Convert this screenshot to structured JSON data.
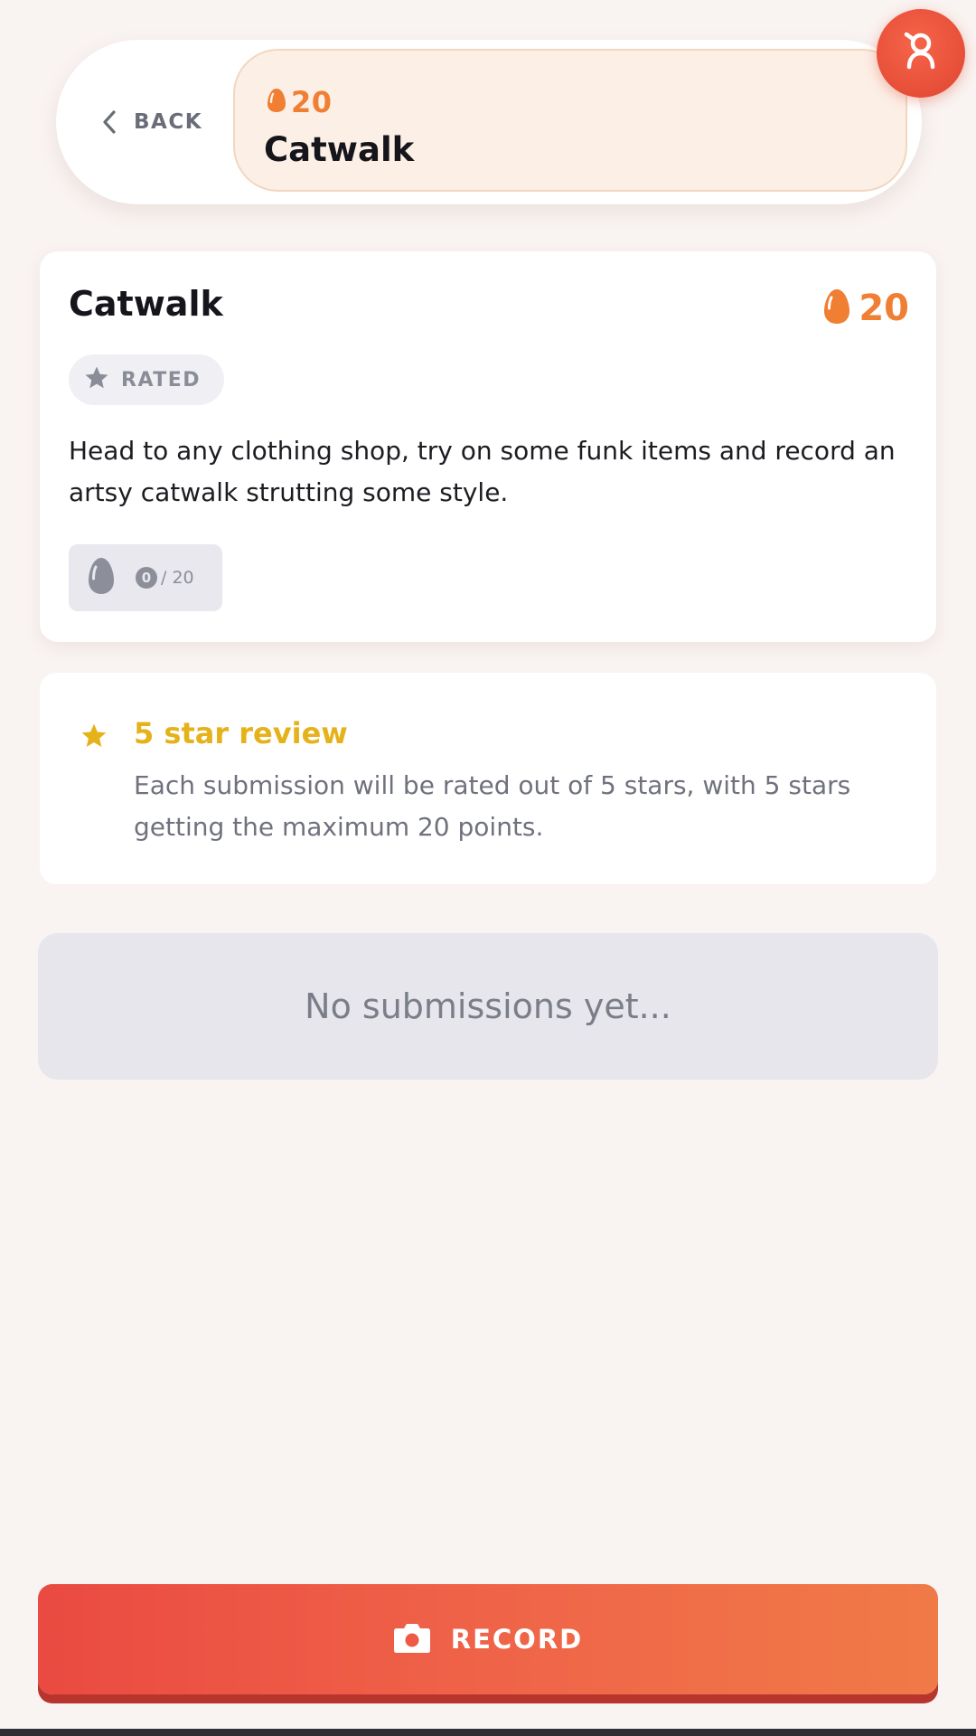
{
  "colors": {
    "accent": "#f07e33",
    "record_gradient_start": "#ea4a41",
    "record_gradient_end": "#f07a47",
    "review_gold": "#e5b21a",
    "background": "#f9f3f1"
  },
  "header": {
    "back_label": "BACK",
    "back_icon": "chevron-left-icon",
    "title_points": "20",
    "title": "Catwalk",
    "avatar_icon": "user-icon"
  },
  "challenge": {
    "title": "Catwalk",
    "points": "20",
    "badge_label": "RATED",
    "badge_icon": "star-icon",
    "description": "Head to any clothing shop, try on some funk items and record an artsy catwalk strutting some style.",
    "progress_current": "0",
    "progress_total": "/ 20",
    "progress_icon": "egg-icon"
  },
  "review": {
    "icon": "star-icon",
    "title": "5 star review",
    "description": "Each submission will be rated out of 5 stars, with 5 stars getting the maximum 20 points."
  },
  "submissions": {
    "empty_text": "No submissions yet..."
  },
  "record": {
    "label": "RECORD",
    "icon": "camera-icon"
  }
}
